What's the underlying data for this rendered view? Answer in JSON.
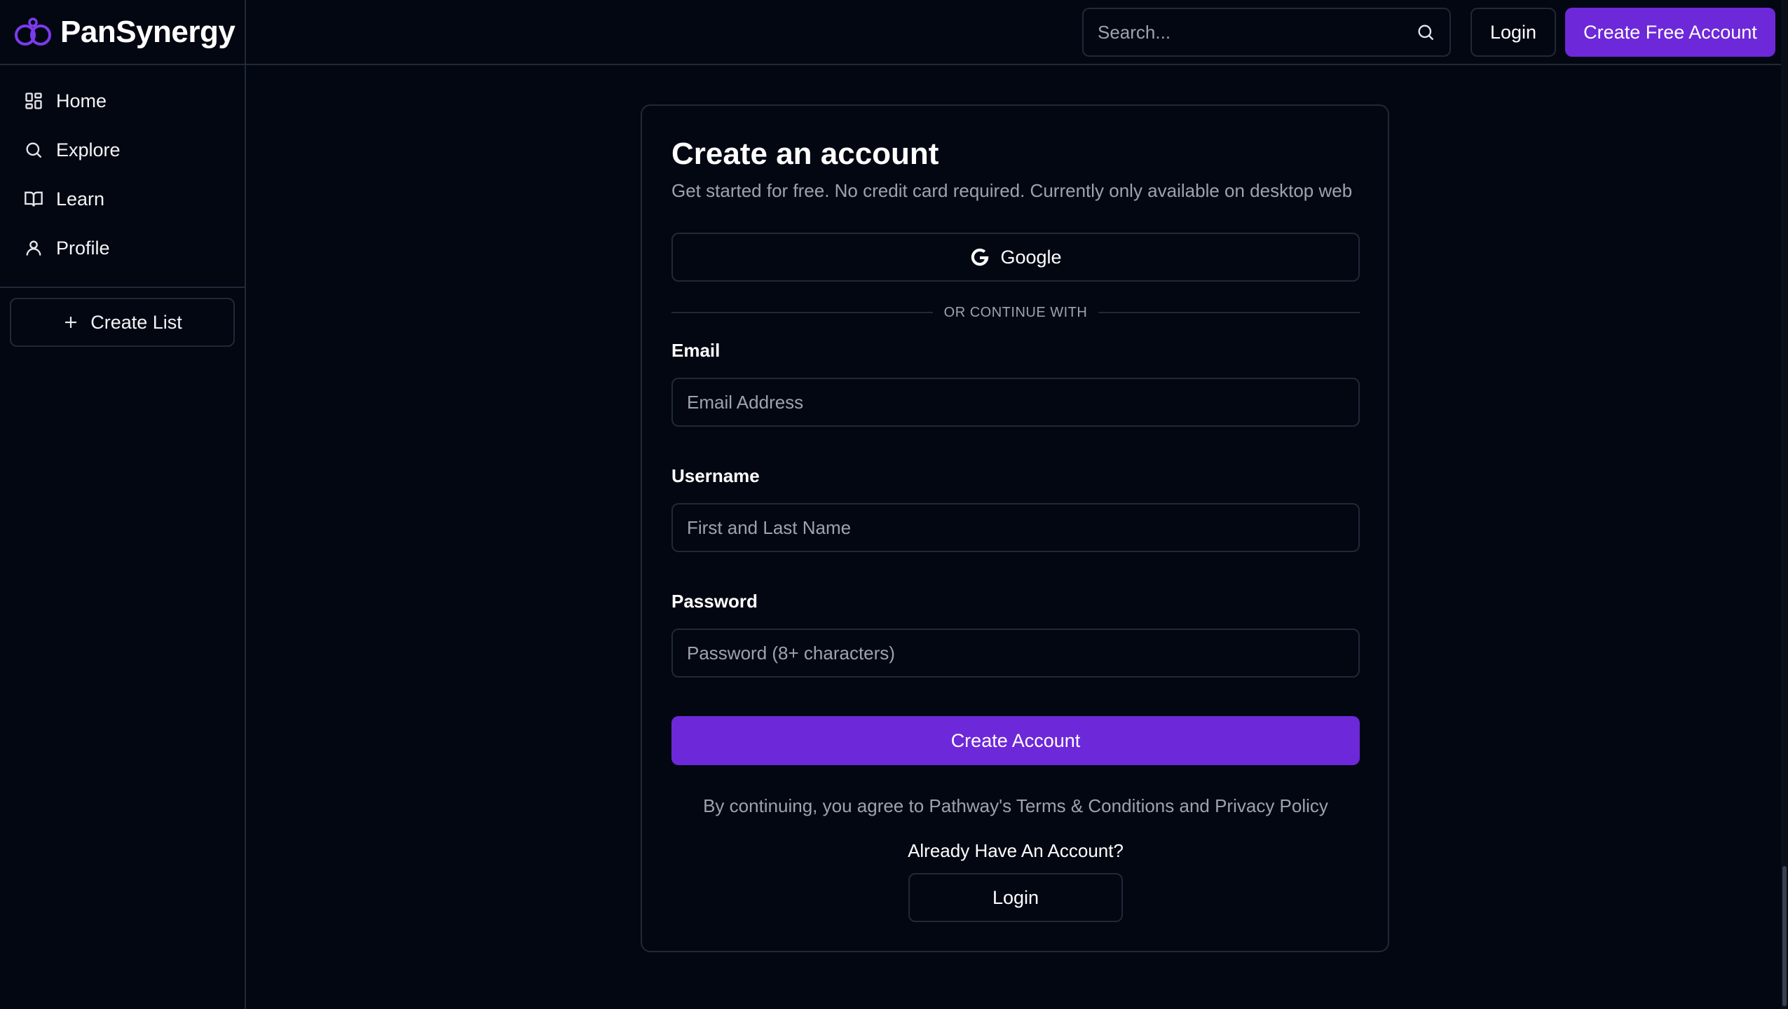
{
  "brand": {
    "name": "PanSynergy"
  },
  "sidebar": {
    "items": [
      {
        "label": "Home",
        "icon": "home-grid-icon"
      },
      {
        "label": "Explore",
        "icon": "search-icon"
      },
      {
        "label": "Learn",
        "icon": "book-open-icon"
      },
      {
        "label": "Profile",
        "icon": "user-icon"
      }
    ],
    "create_list_label": "Create List"
  },
  "header": {
    "search_placeholder": "Search...",
    "login_label": "Login",
    "create_account_label": "Create Free Account"
  },
  "card": {
    "title": "Create an account",
    "subtitle": "Get started for free. No credit card required. Currently only available on desktop web",
    "google_label": "Google",
    "divider_text": "OR CONTINUE WITH",
    "email_label": "Email",
    "email_placeholder": "Email Address",
    "username_label": "Username",
    "username_placeholder": "First and Last Name",
    "password_label": "Password",
    "password_placeholder": "Password (8+ characters)",
    "submit_label": "Create Account",
    "terms_prefix": "By continuing, you agree to Pathway's ",
    "terms_link": "Terms & Conditions",
    "terms_and": " and ",
    "privacy_link": "Privacy Policy",
    "already_text": "Already Have An Account?",
    "login_label": "Login"
  },
  "colors": {
    "background": "#030712",
    "border": "#1f2937",
    "accent": "#6d28d9",
    "muted_text": "#9ca3af"
  }
}
